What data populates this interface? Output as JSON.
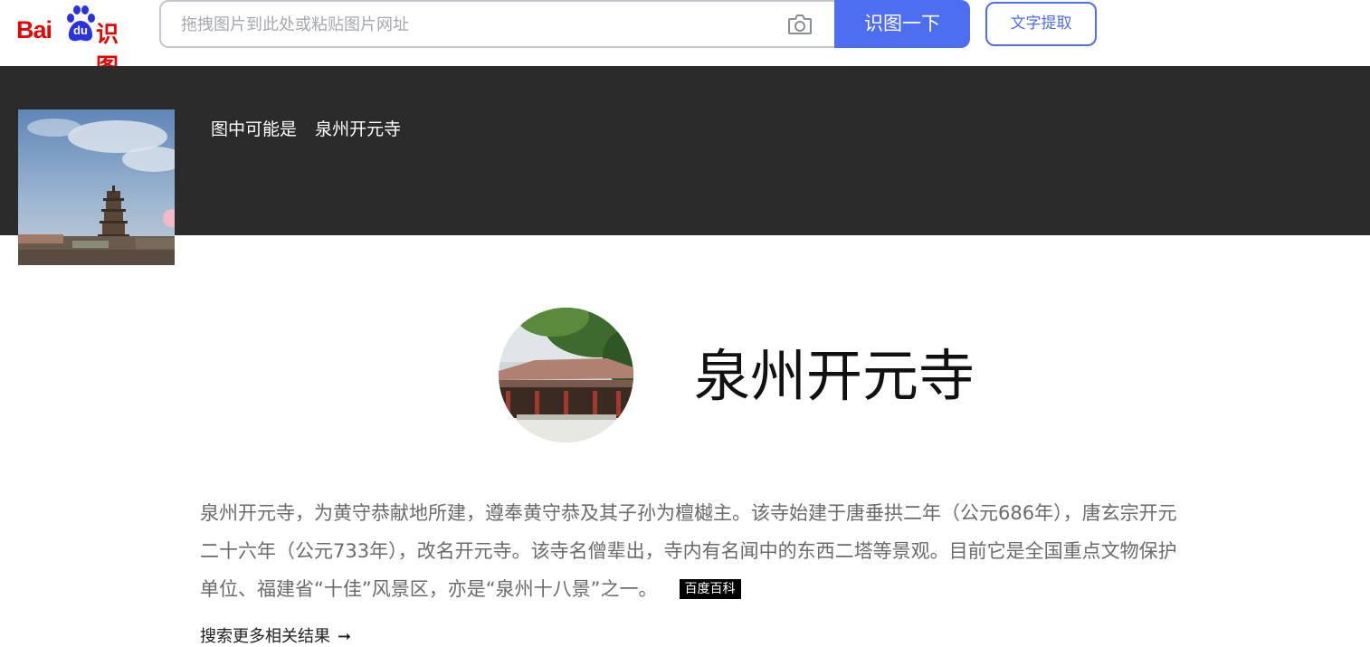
{
  "header": {
    "logo_bai": "Bai",
    "logo_du": "du",
    "logo_shitu": "识图",
    "search_placeholder": "拖拽图片到此处或粘贴图片网址",
    "search_button": "识图一下",
    "ocr_button": "文字提取",
    "accent_color": "#4e6ef2",
    "logo_color": "#e10601"
  },
  "guess": {
    "label": "图中可能是",
    "value": "泉州开元寺"
  },
  "result": {
    "title": "泉州开元寺",
    "description_lines": [
      "泉州开元寺，为黄守恭献地所建，遵奉黄守恭及其子孙为檀樾主。该寺始建于唐垂拱二年（公元686年），唐玄宗开元",
      "二十六年（公元733年），改名开元寺。该寺名僧辈出，寺内有名闻中的东西二塔等景观。目前它是全国重点文物保护",
      "单位、福建省“十佳”风景区，亦是“泉州十八景”之一。"
    ],
    "source_badge": "百度百科",
    "more_link": "搜索更多相关结果",
    "more_arrow": "➞"
  },
  "icons": {
    "camera": "camera-icon",
    "paw": "baidu-paw-icon"
  }
}
